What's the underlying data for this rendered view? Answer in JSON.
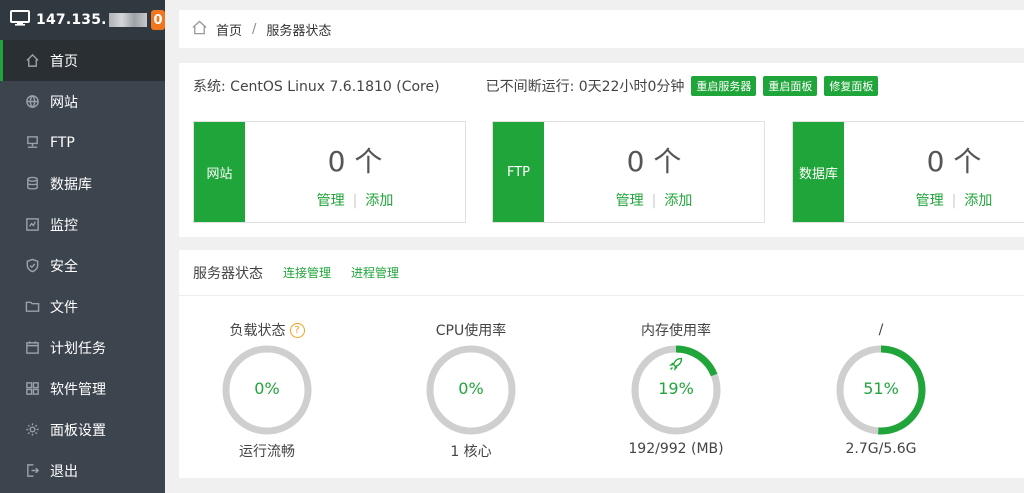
{
  "header": {
    "ip": "147.135.",
    "badge": "0"
  },
  "sidebar": {
    "items": [
      {
        "label": "首页",
        "icon": "home-icon"
      },
      {
        "label": "网站",
        "icon": "globe-icon"
      },
      {
        "label": "FTP",
        "icon": "ftp-icon"
      },
      {
        "label": "数据库",
        "icon": "database-icon"
      },
      {
        "label": "监控",
        "icon": "monitor-icon"
      },
      {
        "label": "安全",
        "icon": "shield-icon"
      },
      {
        "label": "文件",
        "icon": "folder-icon"
      },
      {
        "label": "计划任务",
        "icon": "calendar-icon"
      },
      {
        "label": "软件管理",
        "icon": "apps-icon"
      },
      {
        "label": "面板设置",
        "icon": "gear-icon"
      },
      {
        "label": "退出",
        "icon": "logout-icon"
      }
    ]
  },
  "breadcrumb": {
    "home": "首页",
    "separator": "/",
    "current": "服务器状态"
  },
  "system": {
    "os": "系统: CentOS Linux 7.6.1810 (Core)",
    "uptime": "已不间断运行: 0天22小时0分钟",
    "buttons": [
      "重启服务器",
      "重启面板",
      "修复面板"
    ]
  },
  "cards": [
    {
      "label": "网站",
      "count": "0 个",
      "manage": "管理",
      "add": "添加"
    },
    {
      "label": "FTP",
      "count": "0 个",
      "manage": "管理",
      "add": "添加"
    },
    {
      "label": "数据库",
      "count": "0 个",
      "manage": "管理",
      "add": "添加"
    }
  ],
  "status": {
    "title": "服务器状态",
    "tabs": [
      "连接管理",
      "进程管理"
    ],
    "gauges": [
      {
        "title": "负载状态",
        "percent": 0,
        "value": "0%",
        "foot": "运行流畅",
        "help": "?"
      },
      {
        "title": "CPU使用率",
        "percent": 0,
        "value": "0%",
        "foot": "1 核心"
      },
      {
        "title": "内存使用率",
        "percent": 19,
        "value": "19%",
        "foot": "192/992 (MB)"
      },
      {
        "title": "/",
        "percent": 51,
        "value": "51%",
        "foot": "2.7G/5.6G"
      }
    ]
  },
  "colors": {
    "accent": "#20a53a",
    "sidebar": "#3c444d",
    "warning": "#f0a020",
    "badge": "#f0761f"
  }
}
